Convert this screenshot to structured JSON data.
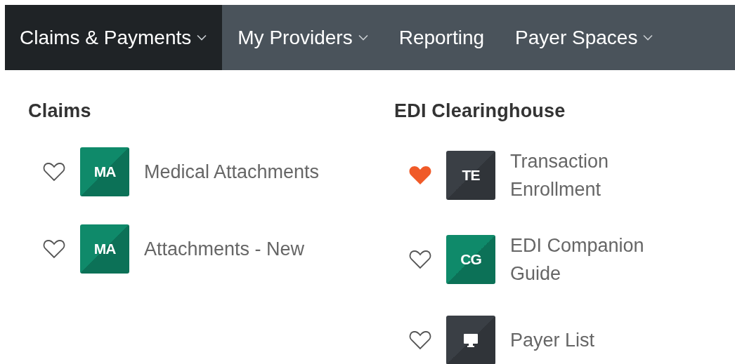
{
  "nav": [
    {
      "label": "Claims & Payments",
      "dropdown": true,
      "selected": true
    },
    {
      "label": "My Providers",
      "dropdown": true,
      "selected": false
    },
    {
      "label": "Reporting",
      "dropdown": false,
      "selected": false
    },
    {
      "label": "Payer Spaces",
      "dropdown": true,
      "selected": false
    }
  ],
  "sections": [
    {
      "title": "Claims",
      "items": [
        {
          "kind": "initials",
          "initials": "MA",
          "color": "#0f8a6a",
          "label": "Medical Attachments",
          "favorite": false
        },
        {
          "kind": "initials",
          "initials": "MA",
          "color": "#0f8a6a",
          "label": "Attachments - New",
          "favorite": false
        }
      ]
    },
    {
      "title": "EDI Clearinghouse",
      "items": [
        {
          "kind": "initials",
          "initials": "TE",
          "color": "#3a3f45",
          "label": "Transaction Enrollment",
          "favorite": true
        },
        {
          "kind": "initials",
          "initials": "CG",
          "color": "#0f8a6a",
          "label": "EDI Companion Guide",
          "favorite": false
        },
        {
          "kind": "icon",
          "color": "#3a3f45",
          "label": "Payer List",
          "favorite": false
        }
      ]
    }
  ]
}
